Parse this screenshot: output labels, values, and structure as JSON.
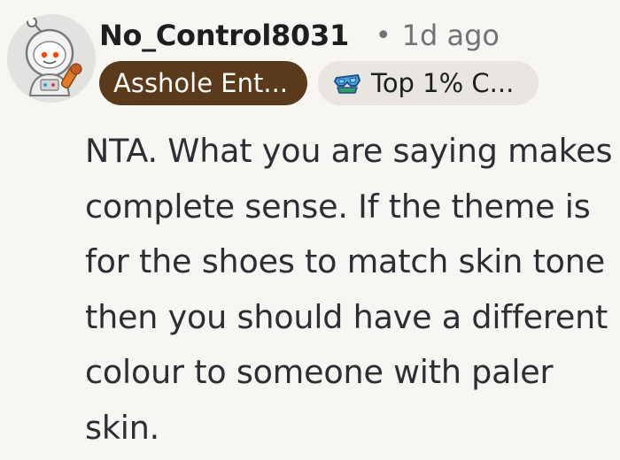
{
  "comment": {
    "author": {
      "username": "No_Control8031",
      "avatar_icon": "snoo-astronaut-avatar"
    },
    "separator": "•",
    "timestamp": "1d ago",
    "flairs": [
      {
        "label": "Asshole Ent...",
        "background": "#5a3a1b",
        "text_color": "#ffffff"
      },
      {
        "label": "Top 1% C...",
        "icon": "top-contributor-goggles-icon",
        "background": "#e9e6e2",
        "text_color": "#1c1e20"
      }
    ],
    "body": "NTA. What you are saying makes complete sense. If the theme is for the shoes to match skin tone then you should have a different colour to someone with paler skin."
  },
  "colors": {
    "background": "#f8f6f3",
    "username": "#1c1e20",
    "meta_text": "#6f7478",
    "body_text": "#2b2f33"
  }
}
